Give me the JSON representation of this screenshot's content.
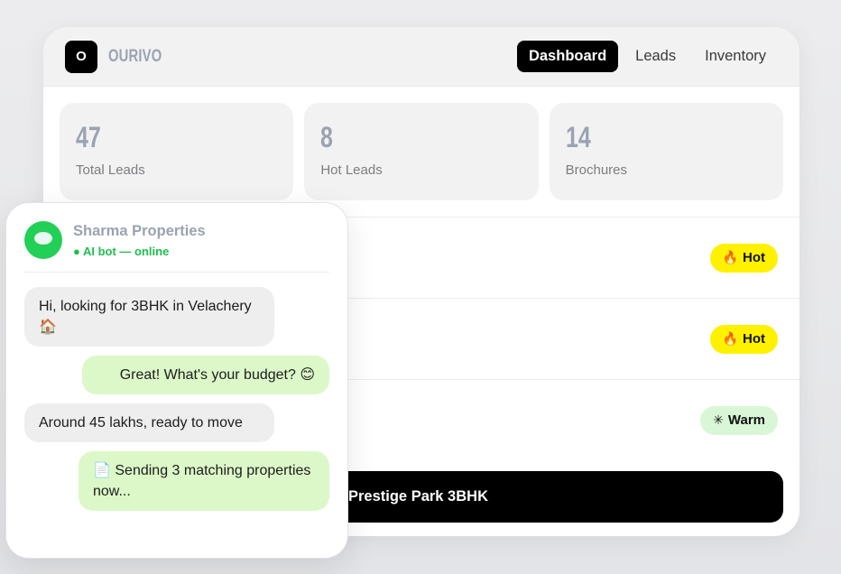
{
  "app": {
    "logo_letter": "O",
    "brand": "OURIVO",
    "nav": [
      {
        "label": "Dashboard",
        "active": true
      },
      {
        "label": "Leads",
        "active": false
      },
      {
        "label": "Inventory",
        "active": false
      }
    ]
  },
  "stats": [
    {
      "value": "47",
      "label": "Total Leads"
    },
    {
      "value": "8",
      "label": "Hot Leads"
    },
    {
      "value": "14",
      "label": "Brochures"
    }
  ],
  "leads": [
    {
      "badge": "Hot",
      "icon": "fire-icon",
      "color": "#fff100"
    },
    {
      "badge": "Hot",
      "icon": "fire-icon",
      "color": "#fff100"
    },
    {
      "badge": "Warm",
      "icon": "snowflake-icon",
      "color": "#d9f7d6"
    }
  ],
  "cta": {
    "label": "Prestige Park 3BHK"
  },
  "chat": {
    "name": "Sharma Properties",
    "status": "● AI bot — online",
    "avatar_icon": "chat-bubble-icon",
    "messages": [
      {
        "direction": "in",
        "text": "Hi, looking for 3BHK in Velachery 🏠"
      },
      {
        "direction": "out",
        "text": "Great! What's your budget? 😊"
      },
      {
        "direction": "in",
        "text": "Around 45 lakhs, ready to move"
      },
      {
        "direction": "out",
        "text": "📄 Sending 3 matching properties now..."
      }
    ]
  },
  "colors": {
    "accent_black": "#000000",
    "hot_yellow": "#fff100",
    "warm_green": "#d9f7d6",
    "online_green": "#1fbf4e",
    "avatar_green": "#22cf57",
    "outgoing_bubble": "#dcf8c8"
  }
}
